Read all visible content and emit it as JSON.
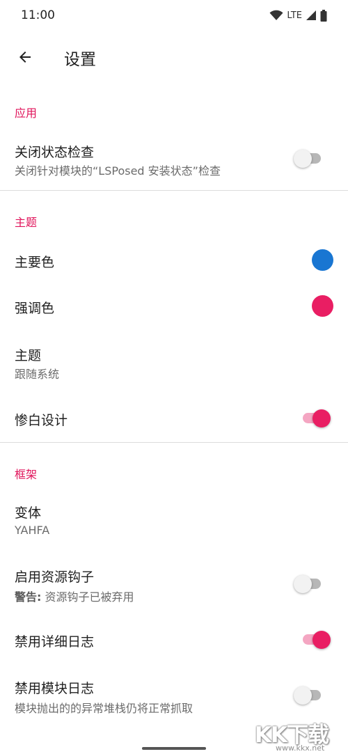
{
  "status_bar": {
    "time": "11:00",
    "network_label": "LTE",
    "icons": [
      "wifi-icon",
      "cellular-signal-icon",
      "battery-icon"
    ]
  },
  "app_bar": {
    "back_icon": "arrow-back-icon",
    "title": "设置"
  },
  "sections": {
    "app": {
      "header": "应用",
      "disable_verify": {
        "title": "关闭状态检查",
        "summary": "关闭针对模块的“LSPosed 安装状态”检查",
        "enabled": false
      }
    },
    "theme": {
      "header": "主题",
      "primary_color": {
        "title": "主要色",
        "color": "#1976d2"
      },
      "accent_color": {
        "title": "强调色",
        "color": "#e91e63"
      },
      "theme_mode": {
        "title": "主题",
        "summary": "跟随系统"
      },
      "pure_black": {
        "title": "惨白设计",
        "enabled": true
      }
    },
    "framework": {
      "header": "框架",
      "variant": {
        "title": "变体",
        "summary": "YAHFA"
      },
      "resource_hook": {
        "title": "启用资源钩子",
        "summary_prefix": "警告:",
        "summary": " 资源钩子已被弃用",
        "enabled": false
      },
      "disable_verbose_log": {
        "title": "禁用详细日志",
        "enabled": true
      },
      "disable_module_log": {
        "title": "禁用模块日志",
        "summary": "模块抛出的的异常堆栈仍将正常抓取",
        "enabled": false
      }
    }
  },
  "watermark": {
    "logo": "KK下载",
    "url": "www.kkx.net"
  },
  "colors": {
    "accent": "#e91e63",
    "primary": "#1976d2",
    "category_text": "#e0135a"
  }
}
